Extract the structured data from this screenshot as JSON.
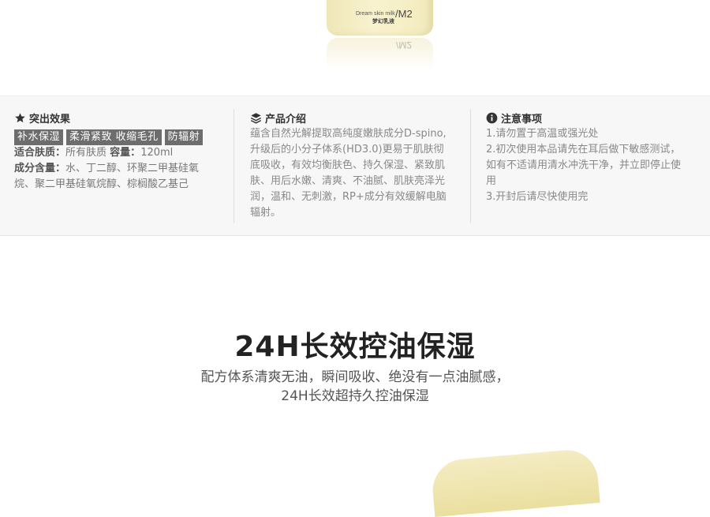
{
  "product": {
    "bottle_en": "Dream skin milk",
    "bottle_cn": "梦幻乳液",
    "bottle_model": "/M2"
  },
  "info": {
    "highlights": {
      "title": "突出效果",
      "tags": [
        "补水保湿",
        "柔滑紧致 收缩毛孔",
        "防辐射"
      ],
      "skin_label": "适合肤质：",
      "skin_value": "所有肤质",
      "volume_label": "容量：",
      "volume_value": "120ml",
      "ingredients_label": "成分含量：",
      "ingredients_value_1": "水、丁二醇、环聚二甲基硅氧",
      "ingredients_value_2": "烷、聚二甲基硅氧烷醇、棕榈酸乙基己"
    },
    "intro": {
      "title": "产品介绍",
      "lines": [
        "蕴含自然光解提取高纯度嫩肤成分D-spino,",
        "升级后的小分子体系(HD3.0)更易于肌肤彻",
        "底吸收，有效均衡肤色、持久保湿、紧致肌",
        "肤、用后水嫩、清爽、不油腻、肌肤亮泽光",
        "润，温和、无刺激，RP+成分有效缓解电脑",
        "辐射。"
      ]
    },
    "notes": {
      "title": "注意事项",
      "lines": [
        "1.请勿置于高温或强光处",
        "2.初次使用本品请先在耳后做下敏感测试，",
        "如有不适请用清水冲洗干净，并立即停止使",
        "用",
        "3.开封后请尽快使用完"
      ]
    }
  },
  "feature": {
    "headline": "24H长效控油保湿",
    "sub_1": "配方体系清爽无油，瞬间吸收、绝没有一点油腻感，",
    "sub_2": "24H长效超持久控油保湿"
  },
  "icons": {
    "highlights": "star-icon",
    "intro": "layers-icon",
    "notes": "info-icon"
  }
}
